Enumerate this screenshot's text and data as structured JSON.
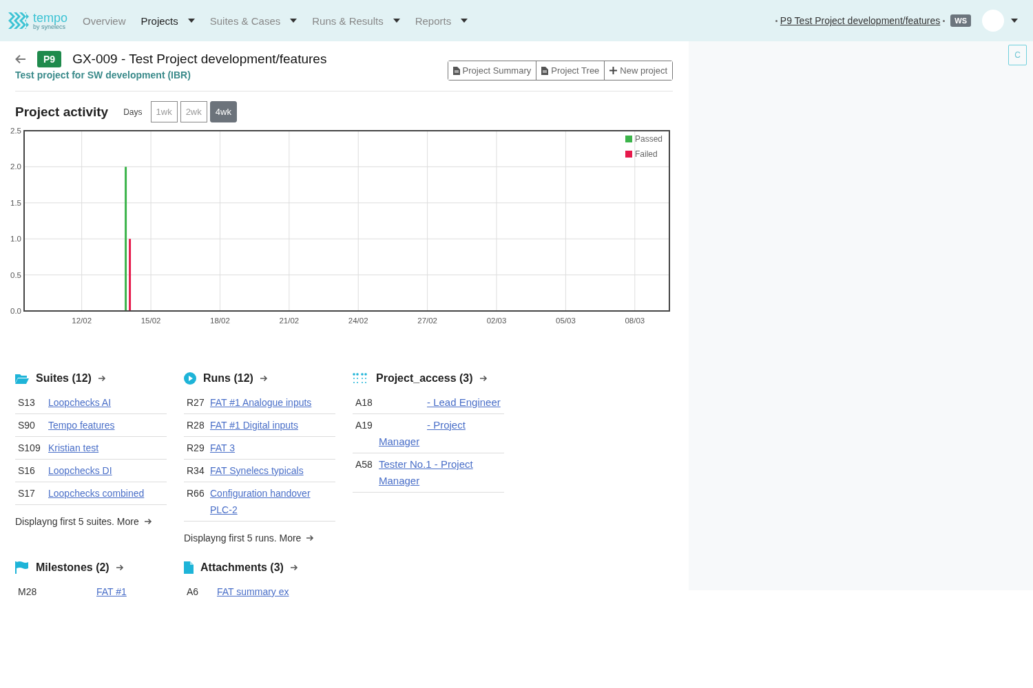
{
  "navbar": {
    "logo_name": "tempo",
    "logo_tagline": "by synelecs",
    "menu": [
      {
        "label": "Overview",
        "selected": false,
        "dropdown": false
      },
      {
        "label": "Projects",
        "selected": true,
        "dropdown": true
      },
      {
        "label": "Suites & Cases",
        "selected": false,
        "dropdown": true
      },
      {
        "label": "Runs & Results",
        "selected": false,
        "dropdown": true
      },
      {
        "label": "Reports",
        "selected": false,
        "dropdown": true
      }
    ],
    "current_project": "P9 Test Project development/features",
    "workspace_badge": "WS"
  },
  "side_panel": {
    "button": "C"
  },
  "project": {
    "badge": "P9",
    "title": "GX-009 - Test Project development/features",
    "subtitle": "Test project for SW development (IBR)",
    "actions": [
      {
        "label": "Project Summary",
        "kind": "document"
      },
      {
        "label": "Project Tree",
        "kind": "document"
      },
      {
        "label": "New project",
        "kind": "create"
      }
    ]
  },
  "activity": {
    "title": "Project activity",
    "range_label": "Days",
    "ranges": [
      {
        "label": "1wk",
        "selected": false
      },
      {
        "label": "2wk",
        "selected": false
      },
      {
        "label": "4wk",
        "selected": true
      }
    ],
    "chart_data": {
      "type": "bar",
      "stacked": false,
      "grid": true,
      "legend": true,
      "categories": [
        null,
        null,
        "12/02",
        null,
        null,
        "15/02",
        null,
        null,
        "18/02",
        null,
        null,
        "21/02",
        null,
        null,
        "24/02",
        null,
        null,
        "27/02",
        null,
        null,
        "02/03",
        null,
        null,
        "05/03",
        null,
        null,
        "08/03",
        null
      ],
      "series": [
        {
          "name": "Passed",
          "color": "#3cb44b",
          "values": [
            0,
            0,
            0,
            0,
            2,
            0,
            0,
            0,
            0,
            0,
            0,
            0,
            0,
            0,
            0,
            0,
            0,
            0,
            0,
            0,
            0,
            0,
            0,
            0,
            0,
            0,
            0,
            0
          ]
        },
        {
          "name": "Failed",
          "color": "#e6194b",
          "values": [
            0,
            0,
            0,
            0,
            1,
            0,
            0,
            0,
            0,
            0,
            0,
            0,
            0,
            0,
            0,
            0,
            0,
            0,
            0,
            0,
            0,
            0,
            0,
            0,
            0,
            0,
            0,
            0
          ]
        }
      ],
      "ylim": [
        0,
        2.5
      ],
      "yticks": [
        {
          "value": 0,
          "label": "0.0"
        },
        {
          "value": 0.5,
          "label": "0.5"
        },
        {
          "value": 1,
          "label": "1.0"
        },
        {
          "value": 1.5,
          "label": "1.5"
        },
        {
          "value": 2,
          "label": "2.0"
        },
        {
          "value": 2.5,
          "label": "2.5"
        }
      ]
    }
  },
  "sections": [
    {
      "kind": "suites",
      "title": "Suites (12)",
      "items": [
        {
          "id": "S13",
          "link": "Loopchecks AI",
          "hidden_name": false
        },
        {
          "id": "S90",
          "link": "Tempo features",
          "hidden_name": false
        },
        {
          "id": "S109",
          "link": "Kristian test",
          "hidden_name": false
        },
        {
          "id": "S16",
          "link": "Loopchecks DI",
          "hidden_name": false
        },
        {
          "id": "S17",
          "link": "Loopchecks combined",
          "hidden_name": false
        }
      ],
      "footer": "Displayng first 5 suites. More"
    },
    {
      "kind": "runs",
      "title": "Runs (12)",
      "items": [
        {
          "id": "R27",
          "link": "FAT #1 Analogue inputs",
          "hidden_name": false
        },
        {
          "id": "R28",
          "link": "FAT #1 Digital inputs",
          "hidden_name": false
        },
        {
          "id": "R29",
          "link": "FAT 3",
          "hidden_name": false
        },
        {
          "id": "R34",
          "link": "FAT Synelecs typicals",
          "hidden_name": false
        },
        {
          "id": "R66",
          "link": "Configuration handover PLC-2",
          "hidden_name": false
        }
      ],
      "footer": "Displayng first 5 runs. More"
    },
    {
      "kind": "access",
      "title": "Project_access (3)",
      "items": [
        {
          "id": "A18",
          "link": "- Lead Engineer",
          "hidden_name": true
        },
        {
          "id": "A19",
          "link": "- Project Manager",
          "hidden_name": true
        },
        {
          "id": "A58",
          "link": "Tester No.1 - Project Manager",
          "hidden_name": false
        }
      ]
    },
    {
      "kind": "milestones",
      "title": "Milestones (2)",
      "items": [
        {
          "id": "M28",
          "link": "FAT #1",
          "hidden_name": true
        }
      ]
    },
    {
      "kind": "attachments",
      "title": "Attachments (3)",
      "items": [
        {
          "id": "A6",
          "link": "FAT summary ex",
          "hidden_name": false
        }
      ]
    }
  ]
}
